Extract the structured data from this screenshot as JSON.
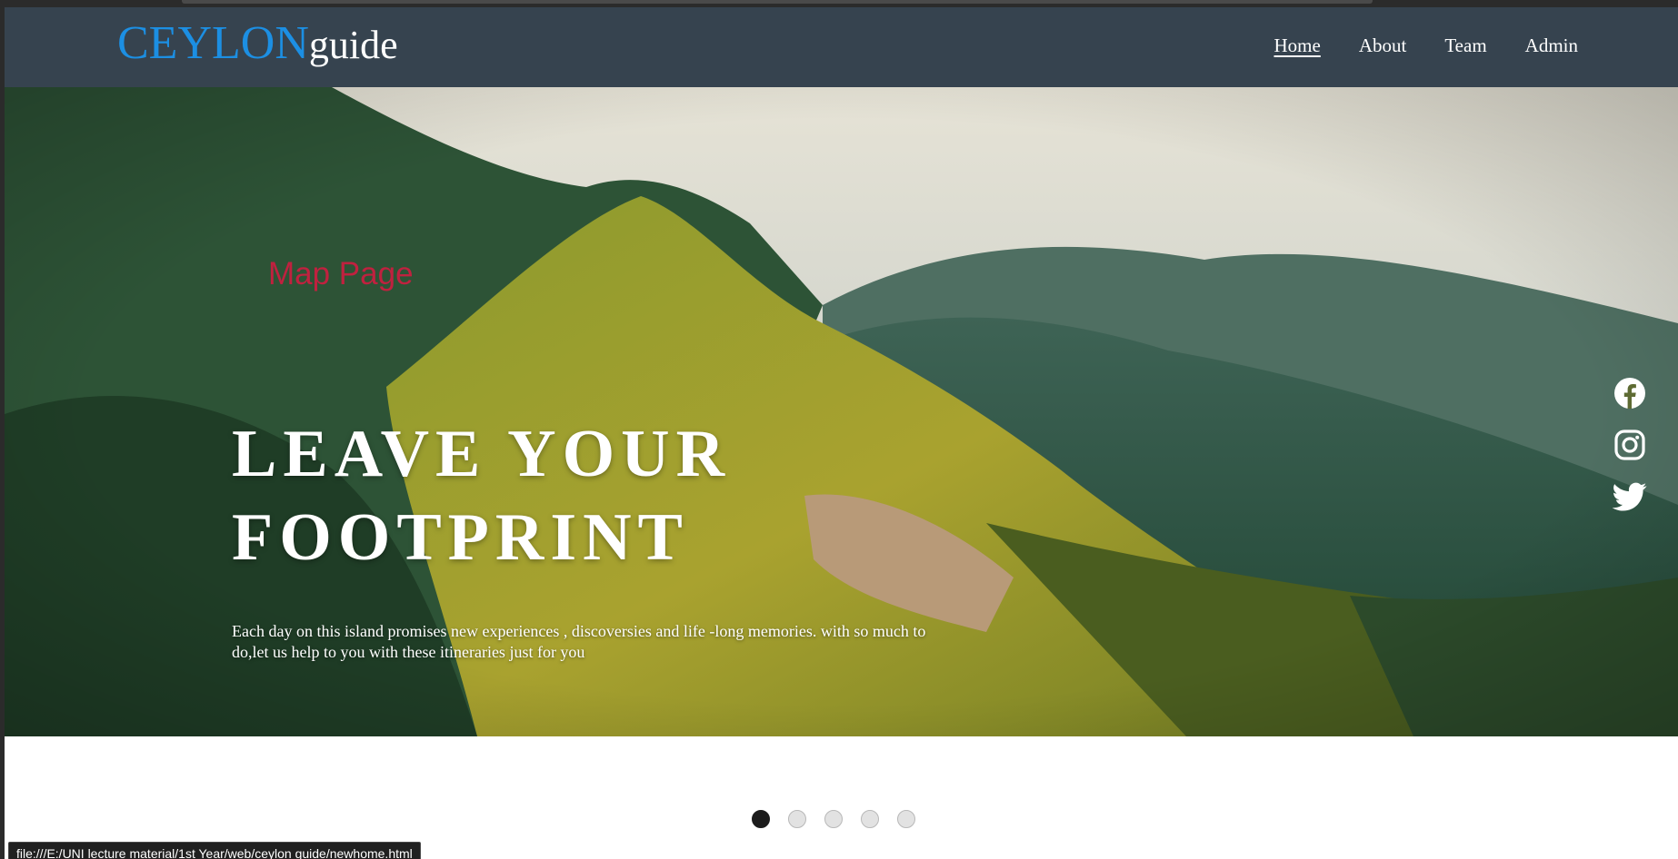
{
  "brand": {
    "part1": "CEYLON",
    "part2": "guide"
  },
  "nav": {
    "items": [
      {
        "label": "Home",
        "active": true
      },
      {
        "label": "About",
        "active": false
      },
      {
        "label": "Team",
        "active": false
      },
      {
        "label": "Admin",
        "active": false
      }
    ]
  },
  "hero": {
    "map_link": "Map Page",
    "headline_line1": "LEAVE YOUR",
    "headline_line2": "FOOTPRINT",
    "tagline": "Each day on this island promises new experiences , discoversies and life -long memories. with so much to do,let us help to you with these itineraries just for you"
  },
  "social": [
    "facebook-icon",
    "instagram-icon",
    "twitter-icon"
  ],
  "carousel": {
    "slide_count": 5,
    "active_index": 0
  },
  "status_bar": {
    "url": "file:///E:/UNI lecture material/1st Year/web/ceylon guide/newhome.html"
  },
  "colors": {
    "nav_bg": "#36434f",
    "brand_blue": "#1c8fe3",
    "map_link": "#c0213f",
    "dot_active": "#1c1c1c",
    "dot_inactive": "#e2e2e2"
  }
}
